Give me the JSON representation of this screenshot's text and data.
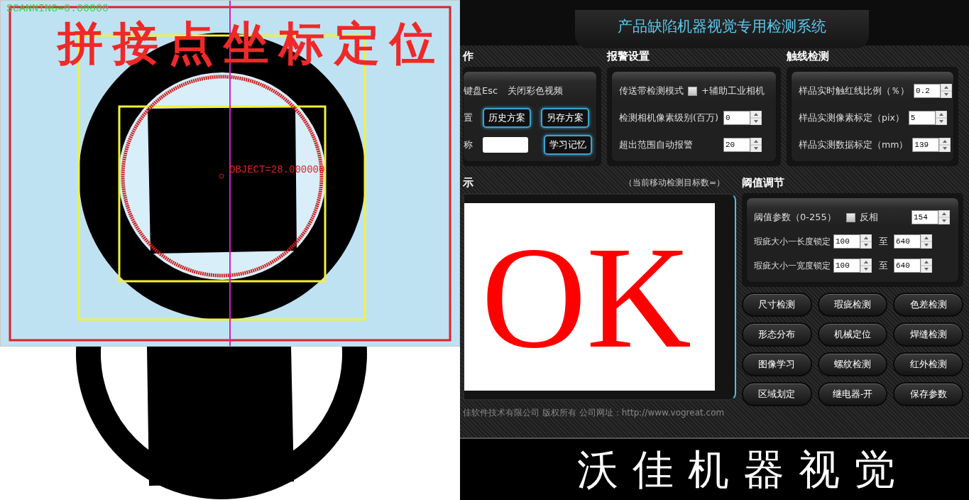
{
  "camera_view": {
    "status_text": "SCANNING=0.00000",
    "caption": "拼接点坐标定位",
    "object_text": "OBJECT=28.000000"
  },
  "app": {
    "title": "产品缺陷机器视觉专用检测系统",
    "operation": {
      "heading": "作",
      "hint_key": "键盘Esc",
      "hint_action": "关闭彩色视频",
      "row2_label": "置",
      "scheme_buttons": [
        "历史方案",
        "另存方案"
      ],
      "row3_label": "称",
      "learn_button": "学习记忆"
    },
    "alarm": {
      "heading": "报警设置",
      "rows": [
        {
          "kind": "checkbox",
          "label": "传送带检测模式",
          "checked": false,
          "note": "+辅助工业相机"
        },
        {
          "kind": "spin",
          "label": "检测相机像素级别(百万)",
          "value": "0"
        },
        {
          "kind": "spin",
          "label": "超出范围自动报警",
          "value": "20"
        }
      ]
    },
    "touch": {
      "heading": "触线检测",
      "rows": [
        {
          "label": "样品实时触红线比例（％）",
          "value": "0.2"
        },
        {
          "label": "样品实测像素标定（pix）",
          "value": "5"
        },
        {
          "label": "样品实测数据标定（mm）",
          "value": "139"
        }
      ]
    },
    "display": {
      "heading": "示",
      "target_count": "（当前移动检测目标数=）",
      "result": "OK"
    },
    "threshold": {
      "heading": "阈值调节",
      "param_label": "阈值参数（0-255）",
      "invert_label": "反相",
      "invert_checked": false,
      "param_value": "154",
      "ranges": [
        {
          "label": "瑕疵大小一长度锁定",
          "from": "100",
          "sep": "至",
          "to": "640"
        },
        {
          "label": "瑕疵大小一宽度锁定",
          "from": "100",
          "sep": "至",
          "to": "640"
        }
      ]
    },
    "buttons": [
      "尺寸检测",
      "瑕疵检测",
      "色差检测",
      "形态分布",
      "机械定位",
      "焊缝检测",
      "图像学习",
      "螺纹检测",
      "红外检测",
      "区域划定",
      "继电器-开",
      "保存参数"
    ],
    "footer": "佳软件技术有限公司  版权所有  公司网址：http://www.vogreat.com"
  },
  "banner": "沃佳机器视觉"
}
